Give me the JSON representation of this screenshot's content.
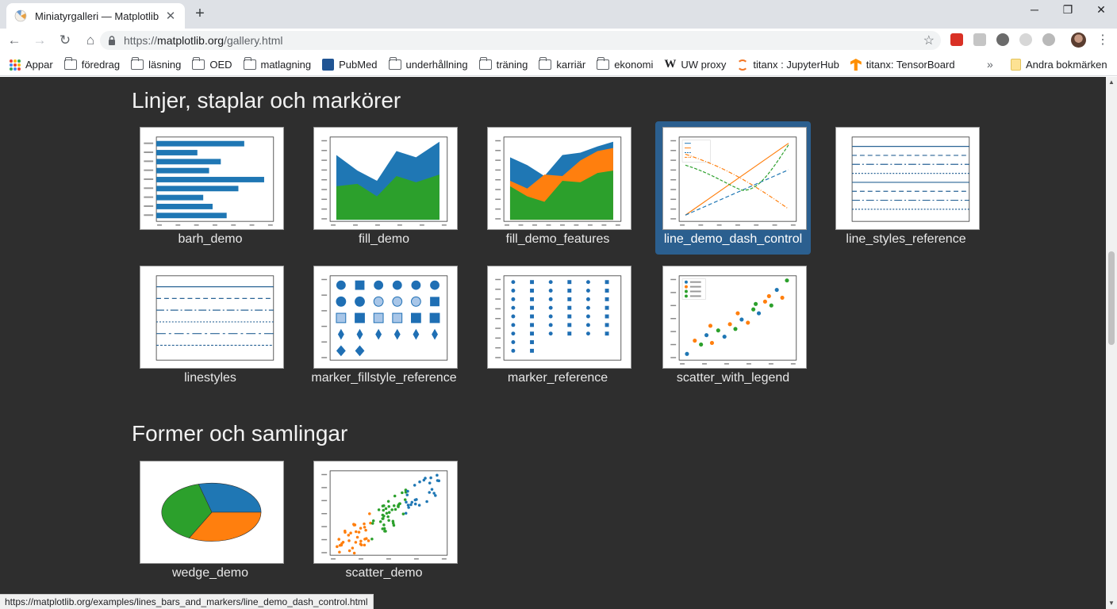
{
  "tab": {
    "title": "Miniatyrgalleri — Matplotlib",
    "close": "✕"
  },
  "newtab": "+",
  "window": {
    "minimize": "─",
    "restore": "❐",
    "close": "✕"
  },
  "nav": {
    "back": "←",
    "forward": "→",
    "reload": "↻",
    "home": "⌂"
  },
  "url": {
    "proto": "https://",
    "host": "matplotlib.org",
    "path": "/gallery.html"
  },
  "bookmarks": [
    {
      "label": "Appar",
      "icon": "apps-grid-icon"
    },
    {
      "label": "föredrag",
      "icon": "folder-icon"
    },
    {
      "label": "läsning",
      "icon": "folder-icon"
    },
    {
      "label": "OED",
      "icon": "folder-icon"
    },
    {
      "label": "matlagning",
      "icon": "folder-icon"
    },
    {
      "label": "PubMed",
      "icon": "pubmed-icon"
    },
    {
      "label": "underhållning",
      "icon": "folder-icon"
    },
    {
      "label": "träning",
      "icon": "folder-icon"
    },
    {
      "label": "karriär",
      "icon": "folder-icon"
    },
    {
      "label": "ekonomi",
      "icon": "folder-icon"
    },
    {
      "label": "UW proxy",
      "icon": "wikipedia-icon"
    },
    {
      "label": "titanx : JupyterHub",
      "icon": "jupyter-icon"
    },
    {
      "label": "titanx: TensorBoard",
      "icon": "tensorflow-icon"
    }
  ],
  "bookmarks_overflow": "»",
  "other_bookmarks": "Andra bokmärken",
  "sections": [
    {
      "title": "Linjer, staplar och markörer",
      "items": [
        "barh_demo",
        "fill_demo",
        "fill_demo_features",
        "line_demo_dash_control",
        "line_styles_reference",
        "linestyles",
        "marker_fillstyle_reference",
        "marker_reference",
        "scatter_with_legend"
      ]
    },
    {
      "title": "Former och samlingar",
      "items": [
        "wedge_demo",
        "scatter_demo"
      ]
    }
  ],
  "active_item": "line_demo_dash_control",
  "status_url": "https://matplotlib.org/examples/lines_bars_and_markers/line_demo_dash_control.html",
  "colors": {
    "blue": "#1f77b4",
    "orange": "#ff7f0e",
    "green": "#2ca02c",
    "active": "#2b5f8f",
    "background": "#2e2e2e"
  }
}
